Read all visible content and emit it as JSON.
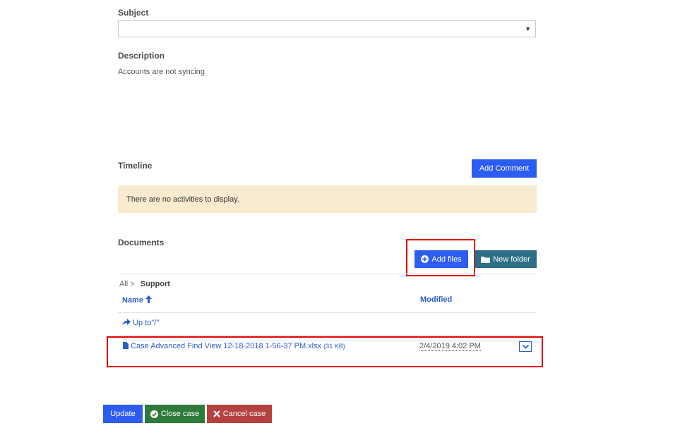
{
  "subject": {
    "label": "Subject",
    "value": ""
  },
  "description": {
    "label": "Description",
    "text": "Accounts are not syncing"
  },
  "timeline": {
    "label": "Timeline",
    "add_comment_label": "Add Comment",
    "empty_message": "There are no activities to display."
  },
  "documents": {
    "label": "Documents",
    "add_files_label": "Add files",
    "new_folder_label": "New folder",
    "breadcrumb": {
      "root": "All",
      "separator": ">",
      "current": "Support"
    },
    "columns": {
      "name": "Name",
      "modified": "Modified"
    },
    "up_link": "Up to\"/\"",
    "files": [
      {
        "name": "Case Advanced Find View 12-18-2018 1-56-37 PM.xlsx",
        "size": "(31 KB)",
        "modified": "2/4/2019 4:02 PM"
      }
    ]
  },
  "actions": {
    "update_label": "Update",
    "close_case_label": "Close case",
    "cancel_case_label": "Cancel case"
  },
  "colors": {
    "primary": "#2d5cf0",
    "teal": "#2e6e86",
    "success": "#2e7a3a",
    "danger": "#b54040",
    "notice_bg": "#f9ebcf",
    "highlight": "#e00000"
  }
}
